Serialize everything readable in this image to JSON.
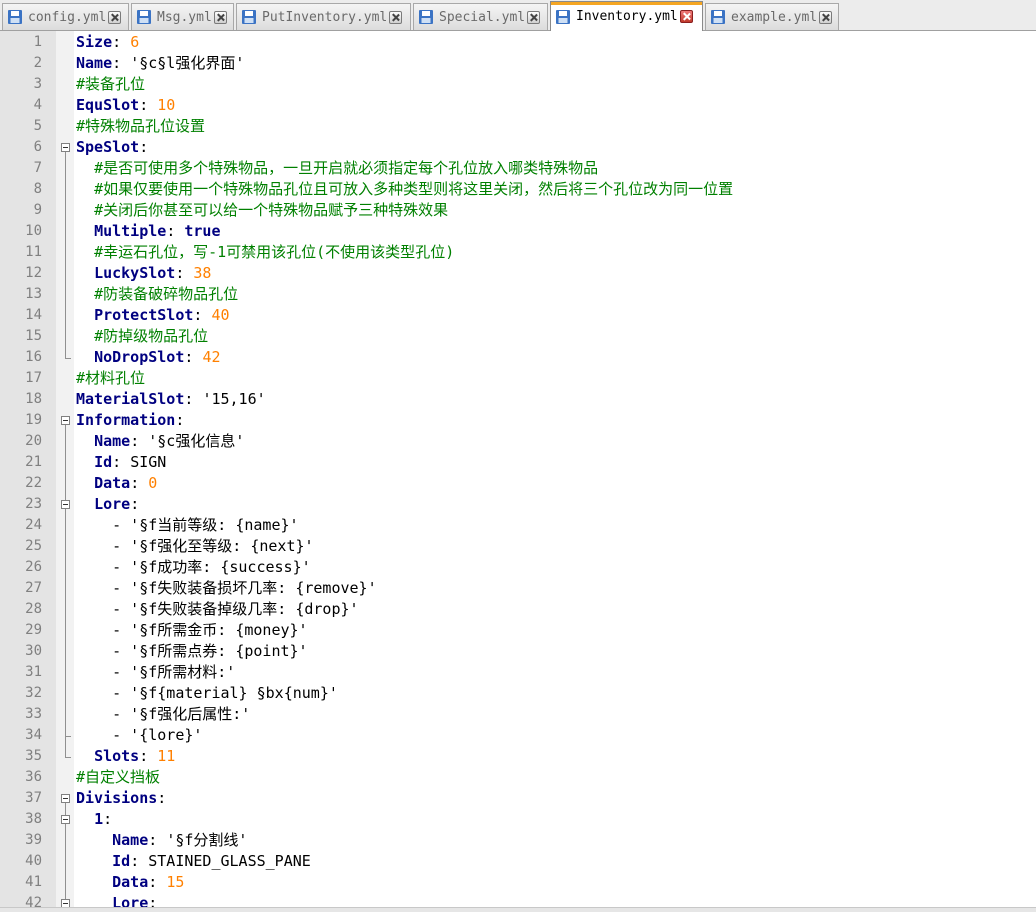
{
  "tabs": [
    {
      "label": "config.yml",
      "active": false
    },
    {
      "label": "Msg.yml",
      "active": false
    },
    {
      "label": "PutInventory.yml",
      "active": false
    },
    {
      "label": "Special.yml",
      "active": false
    },
    {
      "label": "Inventory.yml",
      "active": true
    },
    {
      "label": "example.yml",
      "active": false
    }
  ],
  "colors": {
    "key": "#000080",
    "number": "#ff8000",
    "comment": "#008000",
    "active_tab_accent": "#f5a623"
  },
  "editor": {
    "lines": [
      {
        "n": "1",
        "tokens": [
          [
            "key",
            "Size"
          ],
          [
            "punct",
            ": "
          ],
          [
            "num",
            "6"
          ]
        ]
      },
      {
        "n": "2",
        "tokens": [
          [
            "key",
            "Name"
          ],
          [
            "punct",
            ": "
          ],
          [
            "str",
            "'§c§l强化界面'"
          ]
        ]
      },
      {
        "n": "3",
        "tokens": [
          [
            "comment",
            "#装备孔位"
          ]
        ]
      },
      {
        "n": "4",
        "tokens": [
          [
            "key",
            "EquSlot"
          ],
          [
            "punct",
            ": "
          ],
          [
            "num",
            "10"
          ]
        ]
      },
      {
        "n": "5",
        "tokens": [
          [
            "comment",
            "#特殊物品孔位设置"
          ]
        ]
      },
      {
        "n": "6",
        "tokens": [
          [
            "key",
            "SpeSlot"
          ],
          [
            "punct",
            ":"
          ]
        ]
      },
      {
        "n": "7",
        "tokens": [
          [
            "str",
            "  "
          ],
          [
            "comment",
            "#是否可使用多个特殊物品，一旦开启就必须指定每个孔位放入哪类特殊物品"
          ]
        ]
      },
      {
        "n": "8",
        "tokens": [
          [
            "str",
            "  "
          ],
          [
            "comment",
            "#如果仅要使用一个特殊物品孔位且可放入多种类型则将这里关闭，然后将三个孔位改为同一位置"
          ]
        ]
      },
      {
        "n": "9",
        "tokens": [
          [
            "str",
            "  "
          ],
          [
            "comment",
            "#关闭后你甚至可以给一个特殊物品赋予三种特殊效果"
          ]
        ]
      },
      {
        "n": "10",
        "tokens": [
          [
            "str",
            "  "
          ],
          [
            "key",
            "Multiple"
          ],
          [
            "punct",
            ": "
          ],
          [
            "bool",
            "true"
          ]
        ]
      },
      {
        "n": "11",
        "tokens": [
          [
            "str",
            "  "
          ],
          [
            "comment",
            "#幸运石孔位，写-1可禁用该孔位(不使用该类型孔位)"
          ]
        ]
      },
      {
        "n": "12",
        "tokens": [
          [
            "str",
            "  "
          ],
          [
            "key",
            "LuckySlot"
          ],
          [
            "punct",
            ": "
          ],
          [
            "num",
            "38"
          ]
        ]
      },
      {
        "n": "13",
        "tokens": [
          [
            "str",
            "  "
          ],
          [
            "comment",
            "#防装备破碎物品孔位"
          ]
        ]
      },
      {
        "n": "14",
        "tokens": [
          [
            "str",
            "  "
          ],
          [
            "key",
            "ProtectSlot"
          ],
          [
            "punct",
            ": "
          ],
          [
            "num",
            "40"
          ]
        ]
      },
      {
        "n": "15",
        "tokens": [
          [
            "str",
            "  "
          ],
          [
            "comment",
            "#防掉级物品孔位"
          ]
        ]
      },
      {
        "n": "16",
        "tokens": [
          [
            "str",
            "  "
          ],
          [
            "key",
            "NoDropSlot"
          ],
          [
            "punct",
            ": "
          ],
          [
            "num",
            "42"
          ]
        ]
      },
      {
        "n": "17",
        "tokens": [
          [
            "comment",
            "#材料孔位"
          ]
        ]
      },
      {
        "n": "18",
        "tokens": [
          [
            "key",
            "MaterialSlot"
          ],
          [
            "punct",
            ": "
          ],
          [
            "str",
            "'15,16'"
          ]
        ]
      },
      {
        "n": "19",
        "tokens": [
          [
            "key",
            "Information"
          ],
          [
            "punct",
            ":"
          ]
        ]
      },
      {
        "n": "20",
        "tokens": [
          [
            "str",
            "  "
          ],
          [
            "key",
            "Name"
          ],
          [
            "punct",
            ": "
          ],
          [
            "str",
            "'§c强化信息'"
          ]
        ]
      },
      {
        "n": "21",
        "tokens": [
          [
            "str",
            "  "
          ],
          [
            "key",
            "Id"
          ],
          [
            "punct",
            ": "
          ],
          [
            "str",
            "SIGN"
          ]
        ]
      },
      {
        "n": "22",
        "tokens": [
          [
            "str",
            "  "
          ],
          [
            "key",
            "Data"
          ],
          [
            "punct",
            ": "
          ],
          [
            "num",
            "0"
          ]
        ]
      },
      {
        "n": "23",
        "tokens": [
          [
            "str",
            "  "
          ],
          [
            "key",
            "Lore"
          ],
          [
            "punct",
            ":"
          ]
        ]
      },
      {
        "n": "24",
        "tokens": [
          [
            "str",
            "    - '§f当前等级: {name}'"
          ]
        ]
      },
      {
        "n": "25",
        "tokens": [
          [
            "str",
            "    - '§f强化至等级: {next}'"
          ]
        ]
      },
      {
        "n": "26",
        "tokens": [
          [
            "str",
            "    - '§f成功率: {success}'"
          ]
        ]
      },
      {
        "n": "27",
        "tokens": [
          [
            "str",
            "    - '§f失败装备损坏几率: {remove}'"
          ]
        ]
      },
      {
        "n": "28",
        "tokens": [
          [
            "str",
            "    - '§f失败装备掉级几率: {drop}'"
          ]
        ]
      },
      {
        "n": "29",
        "tokens": [
          [
            "str",
            "    - '§f所需金币: {money}'"
          ]
        ]
      },
      {
        "n": "30",
        "tokens": [
          [
            "str",
            "    - '§f所需点券: {point}'"
          ]
        ]
      },
      {
        "n": "31",
        "tokens": [
          [
            "str",
            "    - '§f所需材料:'"
          ]
        ]
      },
      {
        "n": "32",
        "tokens": [
          [
            "str",
            "    - '§f{material} §bx{num}'"
          ]
        ]
      },
      {
        "n": "33",
        "tokens": [
          [
            "str",
            "    - '§f强化后属性:'"
          ]
        ]
      },
      {
        "n": "34",
        "tokens": [
          [
            "str",
            "    - '{lore}'"
          ]
        ]
      },
      {
        "n": "35",
        "tokens": [
          [
            "str",
            "  "
          ],
          [
            "key",
            "Slots"
          ],
          [
            "punct",
            ": "
          ],
          [
            "num",
            "11"
          ]
        ]
      },
      {
        "n": "36",
        "tokens": [
          [
            "comment",
            "#自定义挡板"
          ]
        ]
      },
      {
        "n": "37",
        "tokens": [
          [
            "key",
            "Divisions"
          ],
          [
            "punct",
            ":"
          ]
        ]
      },
      {
        "n": "38",
        "tokens": [
          [
            "str",
            "  "
          ],
          [
            "key",
            "1"
          ],
          [
            "punct",
            ":"
          ]
        ]
      },
      {
        "n": "39",
        "tokens": [
          [
            "str",
            "    "
          ],
          [
            "key",
            "Name"
          ],
          [
            "punct",
            ": "
          ],
          [
            "str",
            "'§f分割线'"
          ]
        ]
      },
      {
        "n": "40",
        "tokens": [
          [
            "str",
            "    "
          ],
          [
            "key",
            "Id"
          ],
          [
            "punct",
            ": "
          ],
          [
            "str",
            "STAINED_GLASS_PANE"
          ]
        ]
      },
      {
        "n": "41",
        "tokens": [
          [
            "str",
            "    "
          ],
          [
            "key",
            "Data"
          ],
          [
            "punct",
            ": "
          ],
          [
            "num",
            "15"
          ]
        ]
      },
      {
        "n": "42",
        "tokens": [
          [
            "str",
            "    "
          ],
          [
            "key",
            "Lore"
          ],
          [
            "punct",
            ":"
          ]
        ]
      }
    ]
  }
}
